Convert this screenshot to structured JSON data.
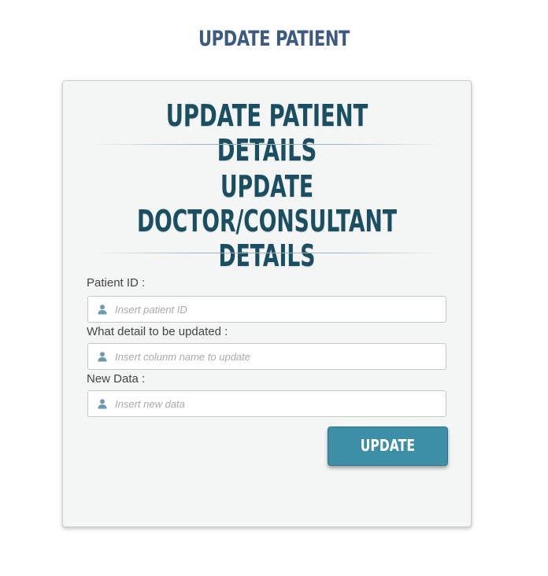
{
  "page": {
    "title": "UPDATE PATIENT"
  },
  "form": {
    "heading_1": "Update Patient Details",
    "heading_2": "Update Doctor/Consultant Details",
    "fields": [
      {
        "label": "Patient ID :",
        "placeholder": "Insert patient ID",
        "value": "",
        "icon": "user-icon"
      },
      {
        "label": "What detail to be updated :",
        "placeholder": "Insert colunm name to update",
        "value": "",
        "icon": "user-icon"
      },
      {
        "label": "New Data :",
        "placeholder": "Insert new data",
        "value": "",
        "icon": "user-icon"
      }
    ],
    "submit_label": "UPDATE"
  },
  "colors": {
    "title": "#3d5a80",
    "heading": "#1a4f62",
    "button": "#3d8fa8",
    "card_background": "#f4f5f5"
  }
}
